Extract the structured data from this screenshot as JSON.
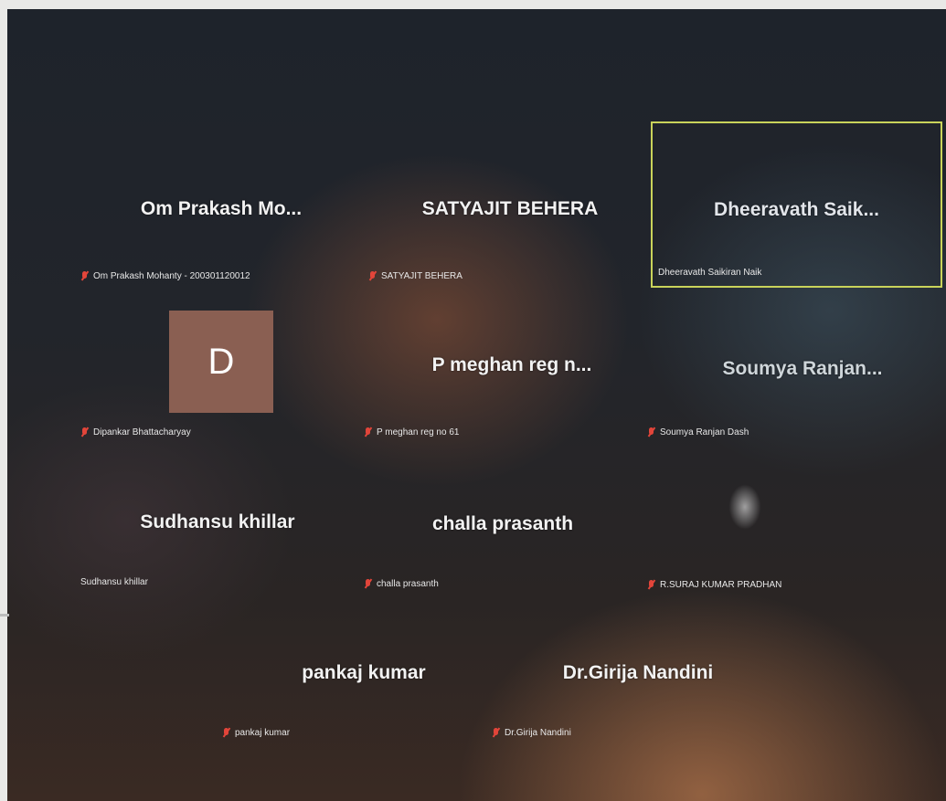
{
  "participants": [
    {
      "display_name": "Om Prakash Mo...",
      "caption": "Om Prakash Mohanty - 200301120012",
      "muted": true
    },
    {
      "display_name": "SATYAJIT BEHERA",
      "caption": "SATYAJIT BEHERA",
      "muted": true
    },
    {
      "display_name": "Dheeravath Saik...",
      "caption": "Dheeravath Saikiran Naik",
      "muted": false,
      "active_speaker": true
    },
    {
      "avatar_letter": "D",
      "caption": "Dipankar Bhattacharyay",
      "muted": true
    },
    {
      "display_name": "P meghan reg n...",
      "caption": "P meghan reg no 61",
      "muted": true
    },
    {
      "display_name": "Soumya Ranjan...",
      "caption": "Soumya Ranjan Dash",
      "muted": true
    },
    {
      "display_name": "Sudhansu khillar",
      "caption": "Sudhansu khillar",
      "muted": false
    },
    {
      "display_name": "challa prasanth",
      "caption": "challa prasanth",
      "muted": true
    },
    {
      "caption": "R.SURAJ KUMAR PRADHAN",
      "muted": true,
      "video_on": true
    },
    {
      "display_name": "pankaj kumar",
      "caption": "pankaj kumar",
      "muted": true
    },
    {
      "display_name": "Dr.Girija Nandini",
      "caption": "Dr.Girija Nandini",
      "muted": true
    }
  ],
  "colors": {
    "active_border": "#c9d35a",
    "mute_icon": "#e2453a",
    "avatar_bg": "#8a5f52"
  }
}
